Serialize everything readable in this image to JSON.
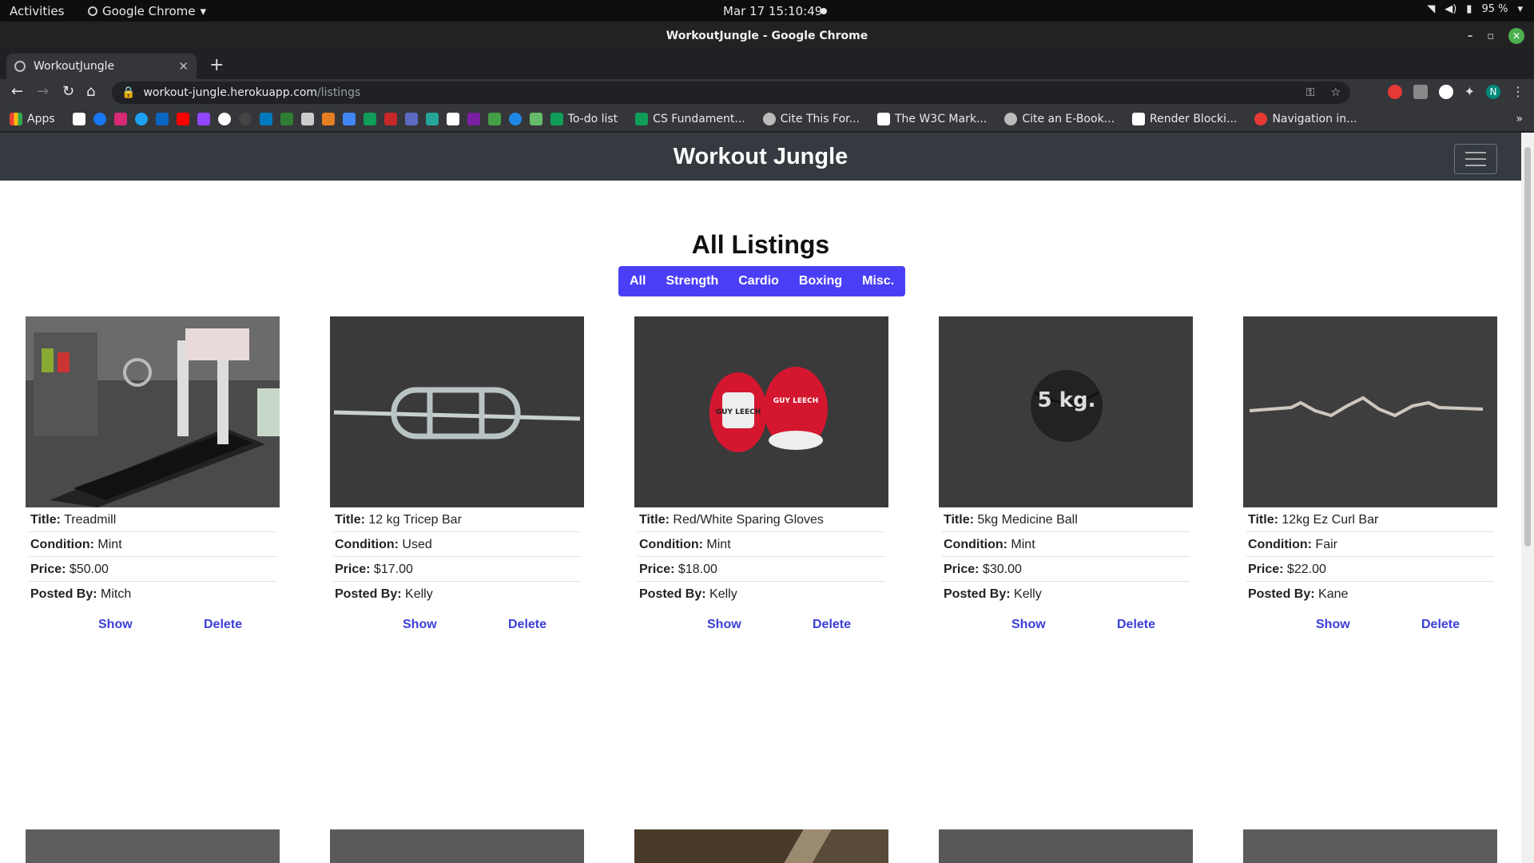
{
  "os_bar": {
    "activities": "Activities",
    "app_name": "Google Chrome",
    "clock": "Mar 17  15:10:49",
    "battery": "95 %"
  },
  "window": {
    "title": "WorkoutJungle - Google Chrome"
  },
  "tab": {
    "title": "WorkoutJungle"
  },
  "address": {
    "host": "workout-jungle.herokuapp.com",
    "path": "/listings"
  },
  "bookmarks": {
    "apps": "Apps",
    "items": [
      "To-do list",
      "CS Fundament...",
      "Cite This For...",
      "The W3C Mark...",
      "Cite an E-Book...",
      "Render Blocki...",
      "Navigation in..."
    ],
    "more": "»"
  },
  "site": {
    "brand": "Workout Jungle",
    "heading": "All Listings",
    "filters": [
      "All",
      "Strength",
      "Cardio",
      "Boxing",
      "Misc."
    ],
    "labels": {
      "title": "Title:",
      "condition": "Condition:",
      "price": "Price:",
      "posted_by": "Posted By:"
    },
    "actions": {
      "show": "Show",
      "delete": "Delete"
    }
  },
  "listings": [
    {
      "title": "Treadmill",
      "condition": "Mint",
      "price": "$50.00",
      "posted_by": "Mitch"
    },
    {
      "title": "12 kg Tricep Bar",
      "condition": "Used",
      "price": "$17.00",
      "posted_by": "Kelly"
    },
    {
      "title": "Red/White Sparing Gloves",
      "condition": "Mint",
      "price": "$18.00",
      "posted_by": "Kelly"
    },
    {
      "title": "5kg Medicine Ball",
      "condition": "Mint",
      "price": "$30.00",
      "posted_by": "Kelly"
    },
    {
      "title": "12kg Ez Curl Bar",
      "condition": "Fair",
      "price": "$22.00",
      "posted_by": "Kane"
    }
  ],
  "image_text": {
    "gloves": "GUY LEECH",
    "ball": "5 kg."
  },
  "colors": {
    "navbar": "#343a40",
    "filter_group": "#4a3ff7",
    "link": "#3b3fd8"
  }
}
